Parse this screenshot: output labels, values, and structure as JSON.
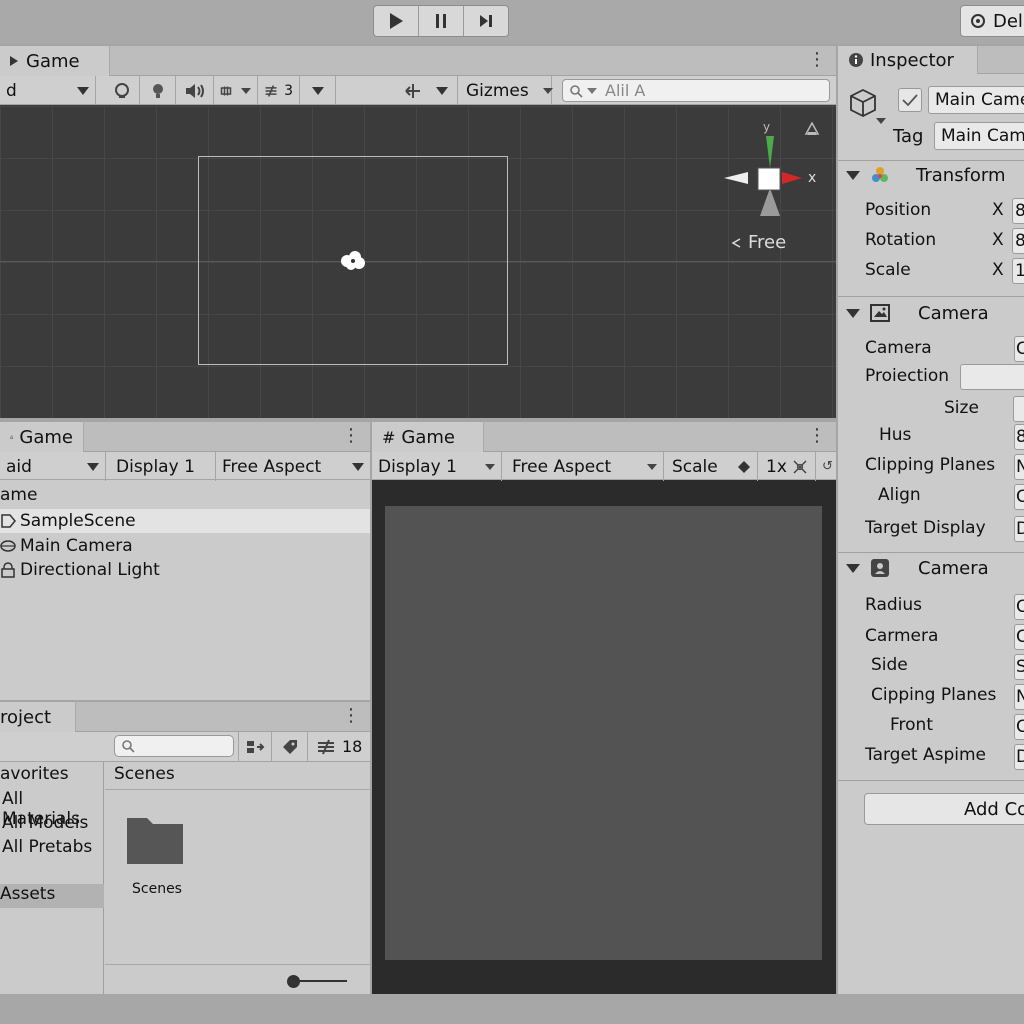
{
  "top_toolbar": {
    "account_label": "Del"
  },
  "scene_view": {
    "tab_label": "Game",
    "draw_mode": "d",
    "layer_count": "3",
    "gizmos_label": "Gizmes",
    "search_placeholder": "Alil A",
    "projection_label": "Free",
    "axis_x_label": "x",
    "axis_y_label": "y"
  },
  "hierarchy": {
    "tab_label": "Game",
    "toolbar_left": "aid",
    "display_label": "Display 1",
    "aspect_label": "Free Aspect",
    "header": "ame",
    "items": [
      {
        "label": "SampleScene"
      },
      {
        "label": "Main Camera"
      },
      {
        "label": "Directional Light"
      }
    ]
  },
  "game_view": {
    "tab_label": "Game",
    "display_label": "Display 1",
    "aspect_label": "Free Aspect",
    "scale_label": "Scale",
    "scale_value": "1x"
  },
  "project": {
    "tab_label": "roject",
    "badge_count": "18",
    "favorites_label": "avorites",
    "favorites": [
      {
        "label": "All Materials"
      },
      {
        "label": "All Modeis"
      },
      {
        "label": "All Pretabs"
      }
    ],
    "assets_label": "Assets",
    "breadcrumb": "Scenes",
    "folder_name": "Scenes"
  },
  "inspector": {
    "tab_label": "Inspector",
    "object_name": "Main Came",
    "tag_label": "Tag",
    "tag_value": "Main Cam",
    "transform": {
      "title": "Transform",
      "rows": [
        {
          "label": "Position",
          "axis": "X",
          "value": "8"
        },
        {
          "label": "Rotation",
          "axis": "X",
          "value": "8"
        },
        {
          "label": "Scale",
          "axis": "X",
          "value": "1"
        }
      ]
    },
    "camera1": {
      "title": "Camera",
      "rows": [
        {
          "label": "Camera",
          "value": "C"
        },
        {
          "label": "Proiection",
          "value": ""
        },
        {
          "label": "Size",
          "value": ""
        },
        {
          "label": "Hus",
          "value": "8"
        },
        {
          "label": "Clipping Planes",
          "value": "N"
        },
        {
          "label": "Align",
          "value": "C"
        },
        {
          "label": "Target Display",
          "value": "D"
        }
      ]
    },
    "camera2": {
      "title": "Camera",
      "rows": [
        {
          "label": "Radius",
          "value": "C"
        },
        {
          "label": "Carmera",
          "value": "C"
        },
        {
          "label": "Side",
          "value": "S"
        },
        {
          "label": "Cipping Planes",
          "value": "N"
        },
        {
          "label": "Front",
          "value": "C"
        },
        {
          "label": "Target Aspime",
          "value": "D"
        }
      ]
    },
    "add_component_label": "Add Co"
  }
}
